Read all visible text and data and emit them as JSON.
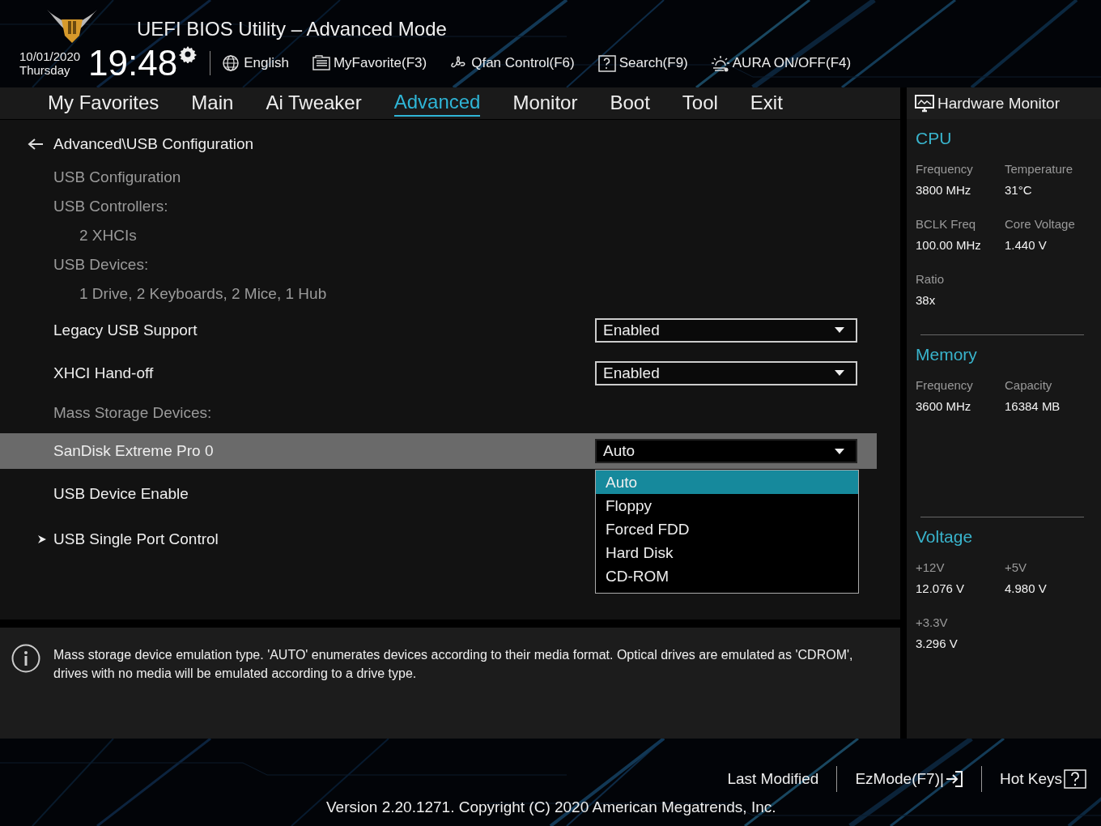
{
  "header": {
    "title": "UEFI BIOS Utility – Advanced Mode",
    "date": "10/01/2020",
    "weekday": "Thursday",
    "time": "19:48",
    "tools": [
      {
        "label": "English"
      },
      {
        "label": "MyFavorite(F3)"
      },
      {
        "label": "Qfan Control(F6)"
      },
      {
        "label": "Search(F9)"
      },
      {
        "label": "AURA ON/OFF(F4)"
      }
    ]
  },
  "tabs": [
    {
      "label": "My Favorites",
      "selected": false
    },
    {
      "label": "Main",
      "selected": false
    },
    {
      "label": "Ai Tweaker",
      "selected": false
    },
    {
      "label": "Advanced",
      "selected": true
    },
    {
      "label": "Monitor",
      "selected": false
    },
    {
      "label": "Boot",
      "selected": false
    },
    {
      "label": "Tool",
      "selected": false
    },
    {
      "label": "Exit",
      "selected": false
    }
  ],
  "breadcrumb": "Advanced\\USB Configuration",
  "settings": [
    {
      "kind": "info",
      "label": "USB Configuration",
      "selected": false
    },
    {
      "kind": "info",
      "label": "USB Controllers:",
      "selected": false
    },
    {
      "kind": "value",
      "label": "2 XHCIs",
      "selected": false
    },
    {
      "kind": "info",
      "label": "USB Devices:",
      "selected": false
    },
    {
      "kind": "value",
      "label": "1 Drive, 2 Keyboards, 2 Mice, 1 Hub",
      "selected": false
    },
    {
      "kind": "dropdown",
      "label": "Legacy USB Support",
      "value": "Enabled",
      "selected": false
    },
    {
      "kind": "dropdown",
      "label": "XHCI Hand-off",
      "value": "Enabled",
      "selected": false
    },
    {
      "kind": "heading",
      "label": "Mass Storage Devices:",
      "selected": false
    },
    {
      "kind": "dropdown",
      "label": "SanDisk Extreme Pro 0",
      "value": "Auto",
      "selected": true,
      "expanded": true,
      "options": [
        {
          "label": "Auto",
          "selected": true
        },
        {
          "label": "Floppy",
          "selected": false
        },
        {
          "label": "Forced FDD",
          "selected": false
        },
        {
          "label": "Hard Disk",
          "selected": false
        },
        {
          "label": "CD-ROM",
          "selected": false
        }
      ]
    },
    {
      "kind": "item",
      "label": "USB Device Enable",
      "selected": false
    },
    {
      "kind": "submenu",
      "label": "USB Single Port Control",
      "selected": false
    }
  ],
  "help": "Mass storage device emulation type. 'AUTO' enumerates devices according to their media format. Optical drives are emulated as 'CDROM', drives with no media will be emulated according to a drive type.",
  "hardware_monitor": {
    "title": "Hardware Monitor",
    "sections": [
      {
        "title": "CPU",
        "items": [
          {
            "label": "Frequency",
            "value": "3800 MHz"
          },
          {
            "label": "Temperature",
            "value": "31°C"
          },
          {
            "label": "BCLK Freq",
            "value": "100.00 MHz"
          },
          {
            "label": "Core Voltage",
            "value": "1.440 V"
          },
          {
            "label": "Ratio",
            "value": "38x"
          }
        ]
      },
      {
        "title": "Memory",
        "items": [
          {
            "label": "Frequency",
            "value": "3600 MHz"
          },
          {
            "label": "Capacity",
            "value": "16384 MB"
          }
        ]
      },
      {
        "title": "Voltage",
        "items": [
          {
            "label": "+12V",
            "value": "12.076 V"
          },
          {
            "label": "+5V",
            "value": "4.980 V"
          },
          {
            "label": "+3.3V",
            "value": "3.296 V"
          }
        ]
      }
    ]
  },
  "footer": {
    "buttons": [
      {
        "label": "Last Modified"
      },
      {
        "label": "EzMode(F7)|"
      },
      {
        "label": "Hot Keys"
      }
    ],
    "version": "Version 2.20.1271. Copyright (C) 2020 American Megatrends, Inc."
  }
}
